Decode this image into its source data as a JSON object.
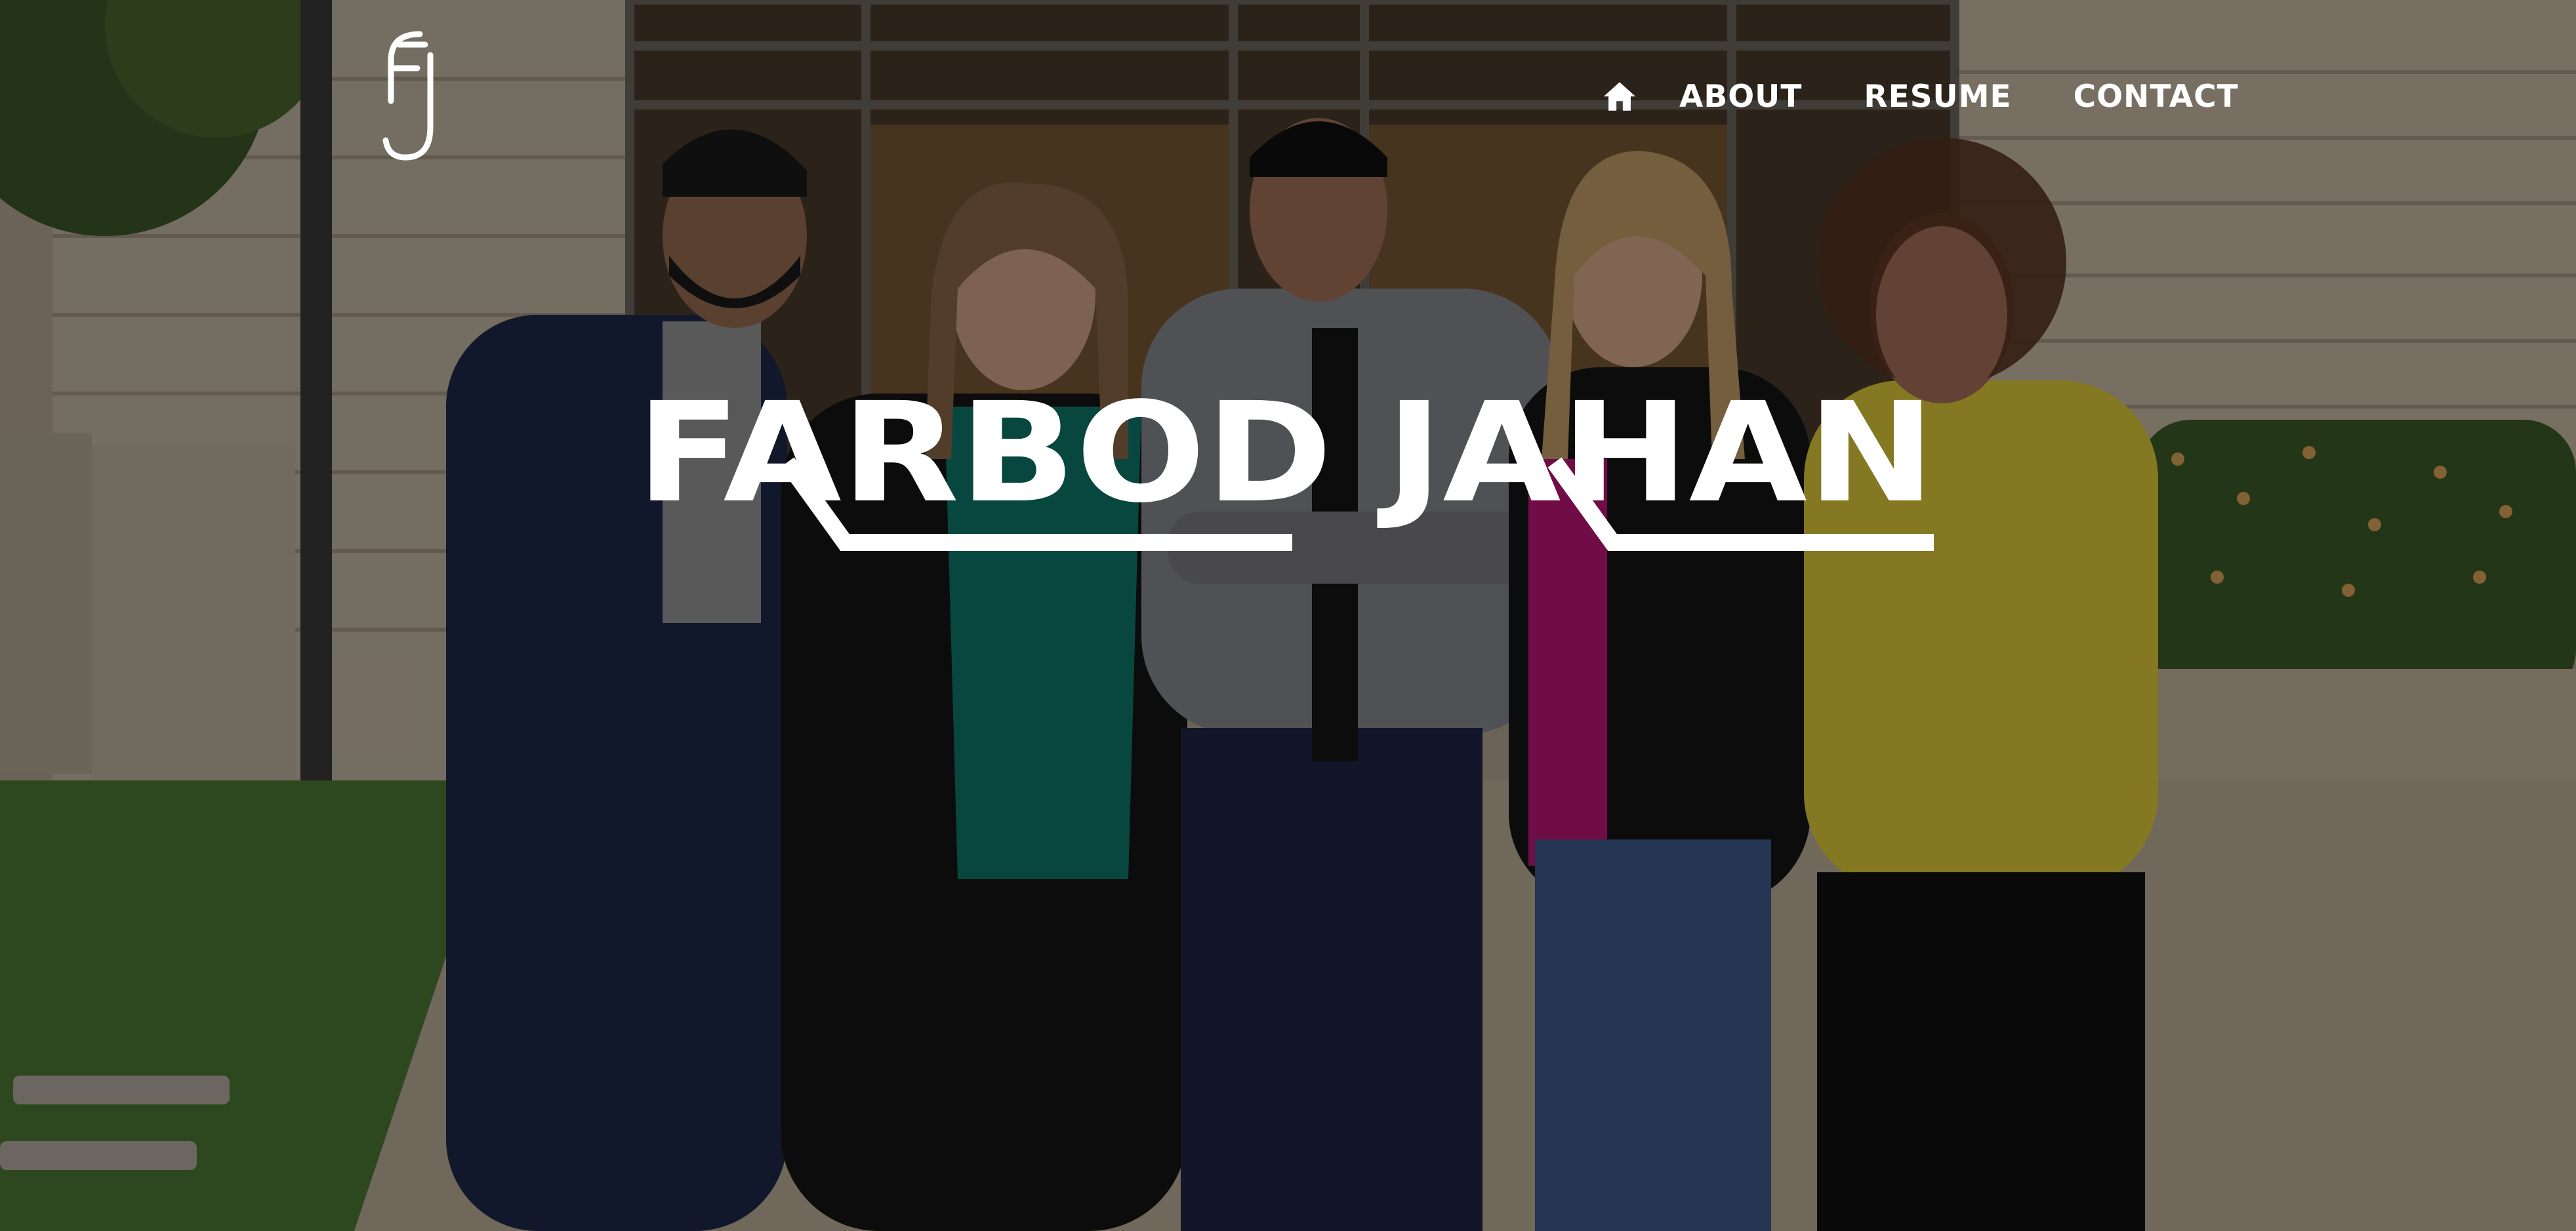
{
  "site": {
    "logo_icon": "fj-monogram-logo",
    "title": "FARBOD JAHAN"
  },
  "nav": {
    "home_icon": "home-icon",
    "items": [
      {
        "label": "ABOUT"
      },
      {
        "label": "RESUME"
      },
      {
        "label": "CONTACT"
      }
    ]
  },
  "hero": {
    "image": "team-photo-five-people-outside-building",
    "overlay_color": "#000000"
  },
  "colors": {
    "text": "#ffffff",
    "jacket_navy": "#1f2a4a",
    "shirt_teal": "#0e7a6f",
    "shirt_yellow": "#e6cf3c",
    "shirt_magenta": "#c2177a"
  }
}
